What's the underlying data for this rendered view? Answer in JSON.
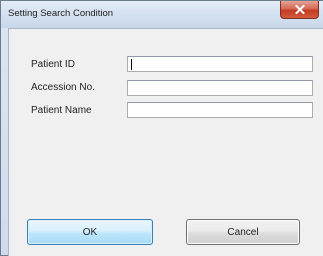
{
  "window": {
    "title": "Setting Search Condition"
  },
  "form": {
    "patient_id": {
      "label": "Patient ID",
      "value": ""
    },
    "accession_no": {
      "label": "Accession No.",
      "value": ""
    },
    "patient_name": {
      "label": "Patient Name",
      "value": ""
    }
  },
  "buttons": {
    "ok_label": "OK",
    "cancel_label": "Cancel"
  },
  "icons": {
    "close": "close-icon"
  },
  "colors": {
    "close_button": "#c9452f",
    "ok_button_border": "#3c7fb1",
    "dialog_background": "#f0f0f0"
  }
}
